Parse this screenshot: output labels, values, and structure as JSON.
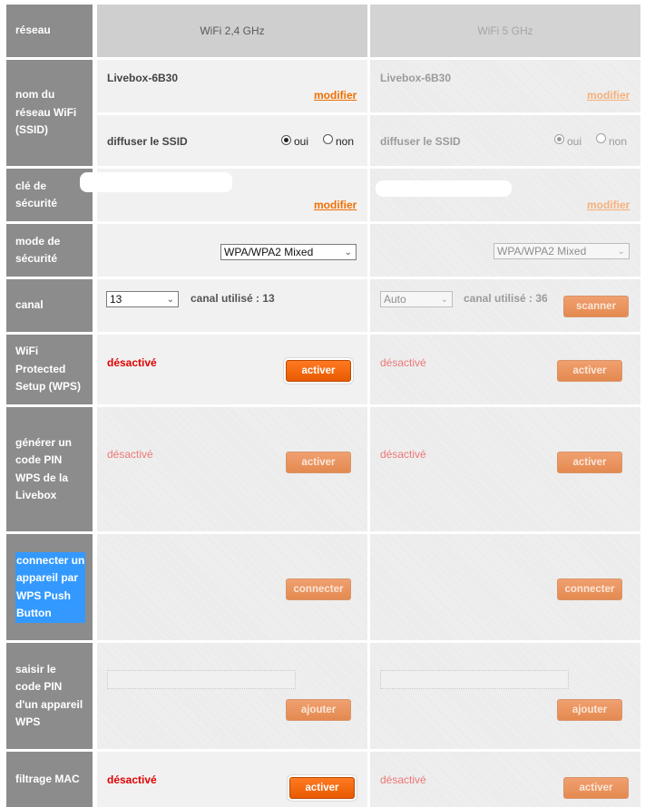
{
  "labels": {
    "network": "réseau",
    "ssid": [
      "nom du",
      "réseau WiFi",
      "(SSID)"
    ],
    "security_key": [
      "clé de",
      "sécurité"
    ],
    "security_mode": [
      "mode de",
      "sécurité"
    ],
    "channel": "canal",
    "wps": [
      "WiFi",
      "Protected",
      "Setup (WPS)"
    ],
    "generate_pin": [
      "générer un",
      "code PIN",
      "WPS de la",
      "Livebox"
    ],
    "push_button": [
      "connecter un",
      "appareil par",
      "WPS Push",
      "Button"
    ],
    "enter_pin": [
      "saisir le",
      "code PIN",
      "d'un appareil",
      "WPS"
    ],
    "mac_filter": "filtrage MAC"
  },
  "columns": {
    "wifi24": "WiFi 2,4 GHz",
    "wifi5": "WiFi 5 GHz"
  },
  "wifi24": {
    "ssid": "Livebox-6B30",
    "modify": "modifier",
    "broadcast_label": "diffuser le SSID",
    "oui": "oui",
    "non": "non",
    "key_modify": "modifier",
    "security_mode": "WPA/WPA2 Mixed",
    "channel": "13",
    "channel_used": "canal utilisé : 13",
    "wps_status": "désactivé",
    "wps_button": "activer",
    "pin_status": "désactivé",
    "pin_button": "activer",
    "push_button": "connecter",
    "add_button": "ajouter",
    "mac_status": "désactivé",
    "mac_button": "activer"
  },
  "wifi5": {
    "ssid": "Livebox-6B30",
    "modify": "modifier",
    "broadcast_label": "diffuser le SSID",
    "oui": "oui",
    "non": "non",
    "key_modify": "modifier",
    "security_mode": "WPA/WPA2 Mixed",
    "channel": "Auto",
    "channel_used": "canal utilisé : 36",
    "scan_button": "scanner",
    "wps_status": "désactivé",
    "wps_button": "activer",
    "pin_status": "désactivé",
    "pin_button": "activer",
    "push_button": "connecter",
    "add_button": "ajouter",
    "mac_status": "désactivé",
    "mac_button": "activer"
  },
  "colors": {
    "accent": "#f16e00",
    "status_off": "#e00000",
    "label_bg": "#8c8c8c"
  }
}
